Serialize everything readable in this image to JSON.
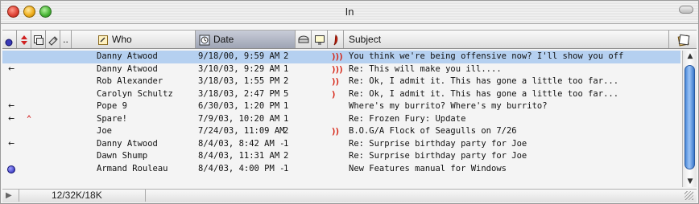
{
  "window": {
    "title": "In"
  },
  "columns": {
    "who": "Who",
    "date": "Date",
    "subject": "Subject",
    "more": ".."
  },
  "messages": [
    {
      "status": "",
      "priority": "",
      "who": "Danny Atwood",
      "date": "9/18/00, 9:59 AM",
      "size": "2",
      "spice": "hot3",
      "subject": "You think we're being offensive now?  I'll show you off",
      "selected": true
    },
    {
      "status": "replied",
      "priority": "",
      "who": "Danny Atwood",
      "date": "3/10/03, 9:29 AM",
      "size": "1",
      "spice": "hot3",
      "subject": "Re: This will make you ill....",
      "selected": false
    },
    {
      "status": "",
      "priority": "",
      "who": "Rob Alexander",
      "date": "3/18/03, 1:55 PM",
      "size": "2",
      "spice": "hot2",
      "subject": "Re: Ok, I admit it.  This has gone a little too far...",
      "selected": false
    },
    {
      "status": "",
      "priority": "",
      "who": "Carolyn Schultz",
      "date": "3/18/03, 2:47 PM",
      "size": "5",
      "spice": "hot1",
      "subject": "Re: Ok, I admit it.  This has gone a little too far...",
      "selected": false
    },
    {
      "status": "replied",
      "priority": "",
      "who": "Pope 9",
      "date": "6/30/03, 1:20 PM",
      "size": "1",
      "spice": "",
      "subject": "Where's my burrito? Where's my burrito?",
      "selected": false
    },
    {
      "status": "replied",
      "priority": "high",
      "who": "Spare!",
      "date": "7/9/03, 10:20 AM",
      "size": "1",
      "spice": "",
      "subject": "Re: Frozen Fury: Update",
      "selected": false
    },
    {
      "status": "",
      "priority": "",
      "who": "Joe",
      "date": "7/24/03, 11:09 AM",
      "size": "2",
      "spice": "hot2",
      "subject": "B.O.G/A Flock of Seagulls on 7/26",
      "selected": false
    },
    {
      "status": "replied",
      "priority": "",
      "who": "Danny Atwood",
      "date": "8/4/03, 8:42 AM -",
      "size": "1",
      "spice": "",
      "subject": "Re: Surprise birthday party for Joe",
      "selected": false
    },
    {
      "status": "",
      "priority": "",
      "who": "Dawn Shump",
      "date": "8/4/03, 11:31 AM",
      "size": "2",
      "spice": "",
      "subject": "Re: Surprise birthday party for Joe",
      "selected": false
    },
    {
      "status": "unread",
      "priority": "",
      "who": "Armand Rouleau",
      "date": "8/4/03, 4:00 PM -",
      "size": "1",
      "spice": "",
      "subject": "New Features manual for Windows",
      "selected": false
    }
  ],
  "footer": {
    "counts": "12/32K/18K"
  }
}
